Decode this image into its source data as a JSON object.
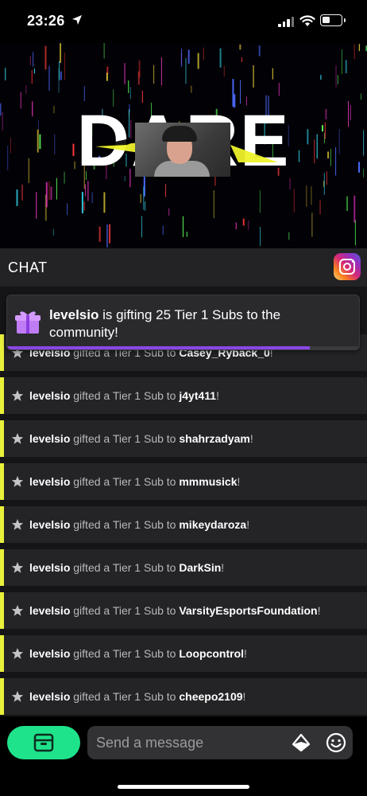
{
  "status_bar": {
    "time": "23:26",
    "location_icon": "location-arrow-icon",
    "signal_icon": "cellular-signal-icon",
    "wifi_icon": "wifi-icon",
    "battery_icon": "battery-icon",
    "battery_level": 0.4
  },
  "video": {
    "overlay_title": "DARE",
    "background_colors": [
      "#ff3bd0",
      "#39e8ff",
      "#ffe23b",
      "#5bff5b",
      "#ff3b3b",
      "#4d6bff"
    ]
  },
  "chat_header": {
    "title": "CHAT",
    "instagram_icon": "instagram-icon"
  },
  "gift_banner": {
    "gifter": "levelsio",
    "message_line": " is gifting 25 Tier 1 Subs to the community!",
    "icon": "gift-box-icon",
    "progress": 0.86,
    "progress_color": "#8a47e6"
  },
  "chat": {
    "accent_color": "#e8f03a",
    "star_icon": "star-icon",
    "messages": [
      {
        "user": "levelsio",
        "action": " gifted a Tier 1 Sub to ",
        "recipient": "Casey_Ryback_0",
        "suffix": "!"
      },
      {
        "user": "levelsio",
        "action": " gifted a Tier 1 Sub to ",
        "recipient": "j4yt411",
        "suffix": "!"
      },
      {
        "user": "levelsio",
        "action": " gifted a Tier 1 Sub to ",
        "recipient": "shahrzadyam",
        "suffix": "!"
      },
      {
        "user": "levelsio",
        "action": " gifted a Tier 1 Sub to ",
        "recipient": "mmmusick",
        "suffix": "!"
      },
      {
        "user": "levelsio",
        "action": " gifted a Tier 1 Sub to ",
        "recipient": "mikeydaroza",
        "suffix": "!"
      },
      {
        "user": "levelsio",
        "action": " gifted a Tier 1 Sub to ",
        "recipient": "DarkSin",
        "suffix": "!"
      },
      {
        "user": "levelsio",
        "action": " gifted a Tier 1 Sub to ",
        "recipient": "VarsityEsportsFoundation",
        "suffix": "!"
      },
      {
        "user": "levelsio",
        "action": " gifted a Tier 1 Sub to ",
        "recipient": "Loopcontrol",
        "suffix": "!"
      },
      {
        "user": "levelsio",
        "action": " gifted a Tier 1 Sub to ",
        "recipient": "cheepo2109",
        "suffix": "!"
      }
    ]
  },
  "bottom_bar": {
    "store_icon": "store-box-icon",
    "store_color": "#1fe38a",
    "input_placeholder": "Send a message",
    "diamond_icon": "diamond-icon",
    "emoji_icon": "emoji-icon"
  }
}
